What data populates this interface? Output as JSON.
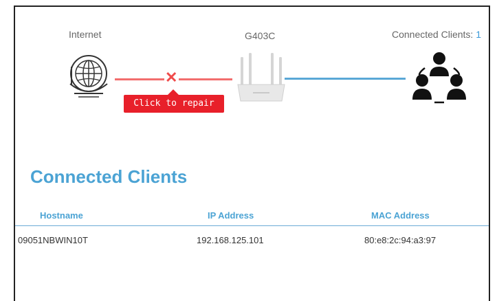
{
  "topology": {
    "internet_label": "Internet",
    "router_label": "G403C",
    "clients_label": "Connected Clients: ",
    "clients_count": "1",
    "repair_label": "Click to repair",
    "x_mark": "✕"
  },
  "clients_section": {
    "title": "Connected Clients",
    "columns": [
      "Hostname",
      "IP Address",
      "MAC Address"
    ],
    "rows": [
      {
        "hostname": "09051NBWIN10T",
        "ip": "192.168.125.101",
        "mac": "80:e8:2c:94:a3:97"
      }
    ]
  },
  "colors": {
    "accent_blue": "#4ba3d4",
    "error_red": "#e8202a",
    "line_red": "#f26d6d",
    "line_blue": "#5aa7d6"
  },
  "icons": [
    "globe-icon",
    "router-icon",
    "users-icon"
  ]
}
